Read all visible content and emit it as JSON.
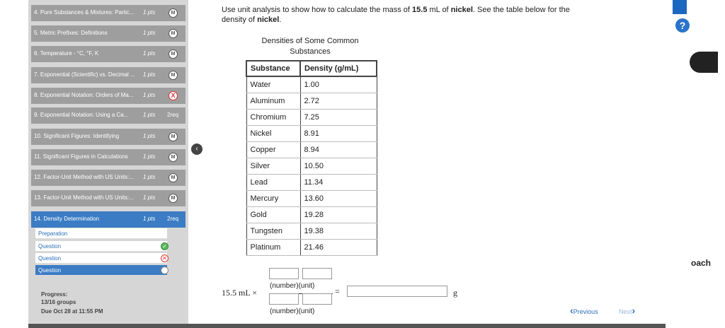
{
  "sidebar": {
    "items": [
      {
        "title": "4. Pure Substances & Mixtures: Partic...",
        "pts": "1 pts",
        "status": "M"
      },
      {
        "title": "5. Metric Prefixes: Definitions",
        "pts": "1 pts",
        "status": "M"
      },
      {
        "title": "6. Temperature - °C, °F, K",
        "pts": "1 pts",
        "status": "M"
      },
      {
        "title": "7. Exponential (Scientific) vs. Decimal ...",
        "pts": "1 pts",
        "status": "M"
      },
      {
        "title": "8. Exponential Notation: Orders of Ma...",
        "pts": "1 pts",
        "status": "X"
      },
      {
        "title": "9. Exponential Notation: Using a Ca...",
        "pts": "1 pts",
        "status": "2req"
      },
      {
        "title": "10. Significant Figures: Identifying",
        "pts": "1 pts",
        "status": "M"
      },
      {
        "title": "11. Significant Figures in Calculations",
        "pts": "1 pts",
        "status": "M"
      },
      {
        "title": "12. Factor-Unit Method with US Units:...",
        "pts": "1 pts",
        "status": "M"
      },
      {
        "title": "13. Factor-Unit Method with US Units:...",
        "pts": "1 pts",
        "status": "M"
      },
      {
        "title": "14. Density Determination",
        "pts": "1 pts",
        "status": "2req"
      }
    ],
    "subitems": [
      {
        "label": "Preparation",
        "state": ""
      },
      {
        "label": "Question",
        "state": "✓"
      },
      {
        "label": "Question",
        "state": "✕"
      },
      {
        "label": "Question",
        "state": ""
      }
    ],
    "progress_label": "Progress:",
    "progress_value": "13/16 groups",
    "due": "Due Oct 28 at 11:55 PM"
  },
  "question": {
    "prompt_pre": "Use unit analysis to show how to calculate the mass of ",
    "prompt_value": "15.5",
    "prompt_mid": " mL of ",
    "prompt_sub": "nickel",
    "prompt_post1": ". See the table below for the",
    "prompt_line2_pre": "density of ",
    "prompt_line2_sub": "nickel",
    "prompt_line2_post": ".",
    "caption_line1": "Densities of Some Common",
    "caption_line2": "Substances",
    "table_headers": [
      "Substance",
      "Density (g/mL)"
    ],
    "table_rows": [
      [
        "Water",
        "1.00"
      ],
      [
        "Aluminum",
        "2.72"
      ],
      [
        "Chromium",
        "7.25"
      ],
      [
        "Nickel",
        "8.91"
      ],
      [
        "Copper",
        "8.94"
      ],
      [
        "Silver",
        "10.50"
      ],
      [
        "Lead",
        "11.34"
      ],
      [
        "Mercury",
        "13.60"
      ],
      [
        "Gold",
        "19.28"
      ],
      [
        "Tungsten",
        "19.38"
      ],
      [
        "Platinum",
        "21.46"
      ]
    ],
    "given": "15.5 mL ×",
    "num_unit_top": "(number)(unit)",
    "num_unit_bottom": "(number)(unit)",
    "equals": "=",
    "answer_unit": "g"
  },
  "nav": {
    "previous": "Previous",
    "next": "Next"
  },
  "right": {
    "help": "?",
    "coach_fragment": "oach"
  }
}
